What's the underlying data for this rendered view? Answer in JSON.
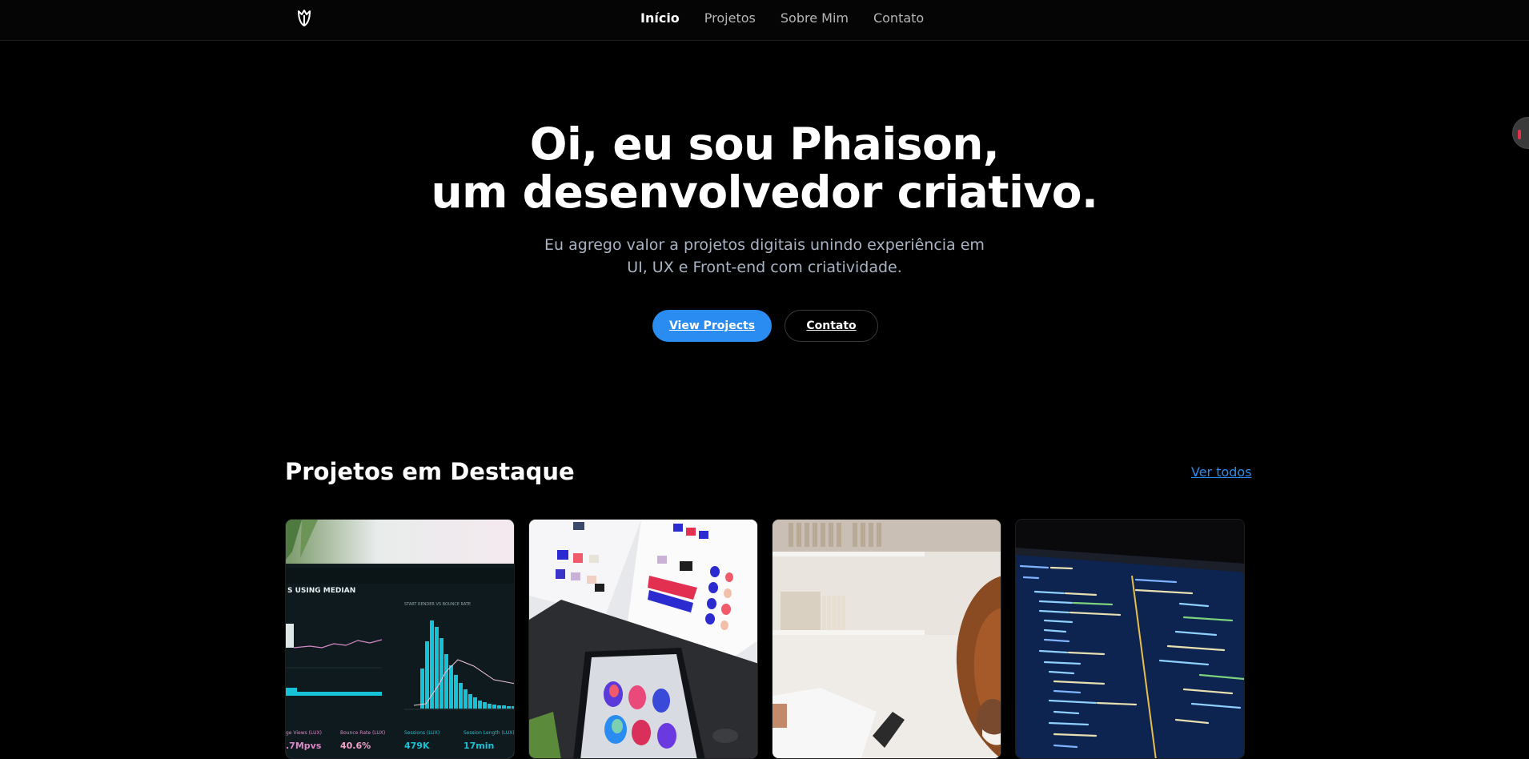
{
  "header": {
    "logo_icon": "leaf-logo-icon",
    "nav": [
      {
        "label": "Início",
        "active": true
      },
      {
        "label": "Projetos",
        "active": false
      },
      {
        "label": "Sobre Mim",
        "active": false
      },
      {
        "label": "Contato",
        "active": false
      }
    ]
  },
  "hero": {
    "title_line1": "Oi, eu sou Phaison,",
    "title_line2": "um desenvolvedor criativo.",
    "subtitle_line1": "Eu agrego valor a projetos digitais unindo experiência em",
    "subtitle_line2": "UI, UX e Front-end com criatividade.",
    "primary_button": "View Projects",
    "secondary_button": "Contato"
  },
  "projects": {
    "title": "Projetos em Destaque",
    "see_all": "Ver todos",
    "cards": [
      {
        "image": "analytics-dashboard-photo",
        "dashboard_header": "S USING MEDIAN",
        "chart_title": "START RENDER VS BOUNCE RATE",
        "metric_labels": [
          "ge Views (LUX)",
          "Bounce Rate (LUX)",
          "Sessions (LUX)",
          "Session Length (LUX)"
        ],
        "metric_values": [
          ".7Mpvs",
          "40.6%",
          "479K",
          "17min"
        ]
      },
      {
        "image": "color-palette-design-photo"
      },
      {
        "image": "person-working-laptop-photo"
      },
      {
        "image": "code-editor-screen-photo"
      }
    ]
  },
  "colors": {
    "background": "#000000",
    "accent": "#2a8cf0",
    "muted_text": "#a9b3c4"
  }
}
